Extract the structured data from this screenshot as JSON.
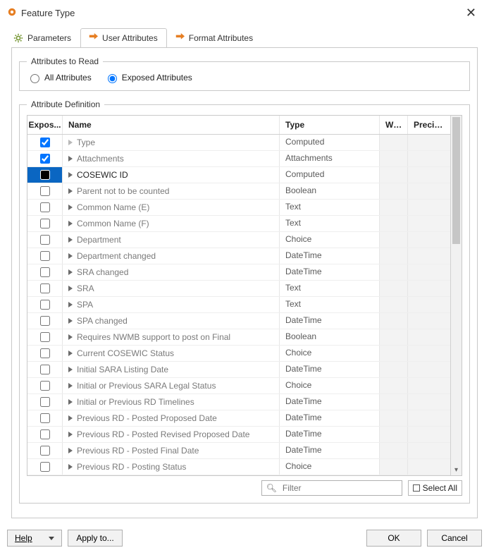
{
  "window": {
    "title": "Feature Type"
  },
  "tabs": {
    "parameters": "Parameters",
    "user_attributes": "User Attributes",
    "format_attributes": "Format Attributes",
    "active": "user_attributes"
  },
  "attributes_to_read": {
    "legend": "Attributes to Read",
    "all_label": "All Attributes",
    "exposed_label": "Exposed Attributes",
    "selected": "exposed"
  },
  "attribute_definition": {
    "legend": "Attribute Definition",
    "columns": {
      "exposed": "Expos...",
      "name": "Name",
      "type": "Type",
      "width": "Wid...",
      "precision": "Precisi..."
    },
    "rows": [
      {
        "exposed": true,
        "name": "Type",
        "type": "Computed",
        "open": true,
        "selected": false
      },
      {
        "exposed": true,
        "name": "Attachments",
        "type": "Attachments",
        "open": false,
        "selected": false
      },
      {
        "exposed": false,
        "name": "COSEWIC ID",
        "type": "Computed",
        "open": false,
        "selected": true
      },
      {
        "exposed": false,
        "name": "Parent not to be counted",
        "type": "Boolean",
        "open": false,
        "selected": false
      },
      {
        "exposed": false,
        "name": "Common Name (E)",
        "type": "Text",
        "open": false,
        "selected": false
      },
      {
        "exposed": false,
        "name": "Common Name (F)",
        "type": "Text",
        "open": false,
        "selected": false
      },
      {
        "exposed": false,
        "name": "Department",
        "type": "Choice",
        "open": false,
        "selected": false
      },
      {
        "exposed": false,
        "name": "Department changed",
        "type": "DateTime",
        "open": false,
        "selected": false
      },
      {
        "exposed": false,
        "name": "SRA changed",
        "type": "DateTime",
        "open": false,
        "selected": false
      },
      {
        "exposed": false,
        "name": "SRA",
        "type": "Text",
        "open": false,
        "selected": false
      },
      {
        "exposed": false,
        "name": "SPA",
        "type": "Text",
        "open": false,
        "selected": false
      },
      {
        "exposed": false,
        "name": "SPA changed",
        "type": "DateTime",
        "open": false,
        "selected": false
      },
      {
        "exposed": false,
        "name": "Requires NWMB support to post on Final",
        "type": "Boolean",
        "open": false,
        "selected": false
      },
      {
        "exposed": false,
        "name": "Current COSEWIC Status",
        "type": "Choice",
        "open": false,
        "selected": false
      },
      {
        "exposed": false,
        "name": "Initial SARA Listing Date",
        "type": "DateTime",
        "open": false,
        "selected": false
      },
      {
        "exposed": false,
        "name": "Initial or Previous SARA Legal Status",
        "type": "Choice",
        "open": false,
        "selected": false
      },
      {
        "exposed": false,
        "name": "Initial or Previous RD Timelines",
        "type": "DateTime",
        "open": false,
        "selected": false
      },
      {
        "exposed": false,
        "name": "Previous RD - Posted Proposed Date",
        "type": "DateTime",
        "open": false,
        "selected": false
      },
      {
        "exposed": false,
        "name": "Previous RD - Posted Revised Proposed Date",
        "type": "DateTime",
        "open": false,
        "selected": false
      },
      {
        "exposed": false,
        "name": "Previous RD - Posted Final Date",
        "type": "DateTime",
        "open": false,
        "selected": false
      },
      {
        "exposed": false,
        "name": "Previous RD - Posting Status",
        "type": "Choice",
        "open": false,
        "selected": false
      }
    ]
  },
  "filter": {
    "placeholder": "Filter"
  },
  "select_all_label": "Select All",
  "buttons": {
    "help": "Help",
    "apply_to": "Apply to...",
    "ok": "OK",
    "cancel": "Cancel"
  }
}
